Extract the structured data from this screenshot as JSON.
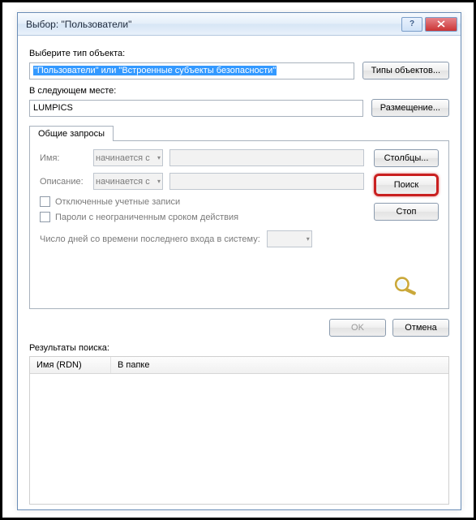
{
  "titlebar": {
    "title": "Выбор: \"Пользователи\""
  },
  "object_type": {
    "label": "Выберите тип объекта:",
    "value": "\"Пользователи\" или \"Встроенные субъекты безопасности\"",
    "button": "Типы объектов..."
  },
  "location": {
    "label": "В следующем месте:",
    "value": "LUMPICS",
    "button": "Размещение..."
  },
  "tab": {
    "label": "Общие запросы"
  },
  "query": {
    "name_label": "Имя:",
    "desc_label": "Описание:",
    "name_op": "начинается с",
    "desc_op": "начинается с",
    "cb_disabled": "Отключенные учетные записи",
    "cb_password": "Пароли с неограниченным сроком действия",
    "days_label": "Число дней со времени последнего входа в систему:"
  },
  "side_buttons": {
    "columns": "Столбцы...",
    "search": "Поиск",
    "stop": "Стоп"
  },
  "bottom": {
    "ok": "OK",
    "cancel": "Отмена"
  },
  "results": {
    "label": "Результаты поиска:",
    "col_name": "Имя (RDN)",
    "col_folder": "В папке"
  }
}
